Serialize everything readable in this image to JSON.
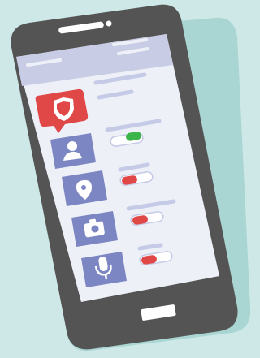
{
  "colors": {
    "background": "#cde8e6",
    "phone_shadow": "#a9d5d2",
    "phone_body": "#545454",
    "screen": "#eef0f8",
    "header_bar": "#c8cce4",
    "placeholder_line": "#c5cae6",
    "tile": "#7b86c2",
    "shield_badge": "#e04848",
    "toggle_on": "#3bb54a",
    "toggle_off": "#e04848",
    "toggle_track": "#ffffff"
  },
  "screen": {
    "title_placeholder": true
  },
  "permissions": [
    {
      "icon": "shield-icon",
      "role": "header",
      "state": "none"
    },
    {
      "icon": "user-icon",
      "role": "contacts",
      "state": "on"
    },
    {
      "icon": "location-pin-icon",
      "role": "location",
      "state": "off"
    },
    {
      "icon": "camera-icon",
      "role": "camera",
      "state": "off"
    },
    {
      "icon": "microphone-icon",
      "role": "microphone",
      "state": "off"
    }
  ]
}
